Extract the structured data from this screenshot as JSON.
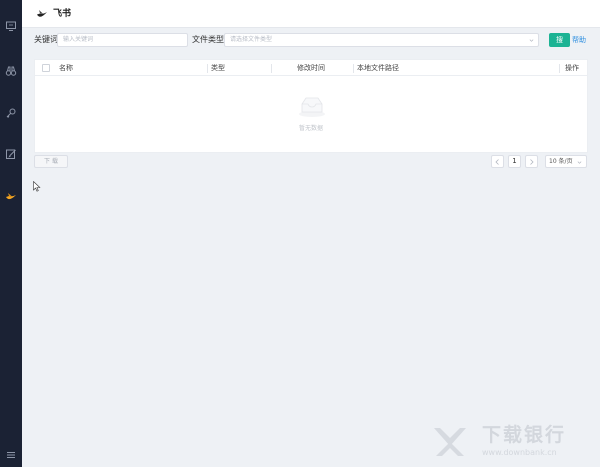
{
  "app": {
    "title": "飞书"
  },
  "sidebar": {
    "items": [
      {
        "icon": "monitor-icon"
      },
      {
        "icon": "binoculars-icon"
      },
      {
        "icon": "key-icon"
      },
      {
        "icon": "edit-icon"
      },
      {
        "icon": "feishu-bird-icon",
        "active": true
      },
      {
        "icon": "menu-icon"
      }
    ]
  },
  "search": {
    "keyword_label": "关键词",
    "keyword_placeholder": "输入关键词",
    "filetype_label": "文件类型",
    "filetype_placeholder": "请选择文件类型",
    "search_button": "搜",
    "help_link": "帮助"
  },
  "table": {
    "columns": [
      "名称",
      "类型",
      "修改时间",
      "本地文件路径",
      "操作"
    ],
    "rows": [],
    "empty_text": "暂无数据"
  },
  "footer": {
    "download_button": "下 载",
    "current_page": "1",
    "page_size": "10 条/页"
  },
  "watermark": {
    "cn": "下载银行",
    "en": "www.downbank.cn"
  },
  "colors": {
    "sidebar_bg": "#1b2234",
    "accent": "#1cb394",
    "link": "#2f8fe0",
    "page_bg": "#eef1f5"
  }
}
